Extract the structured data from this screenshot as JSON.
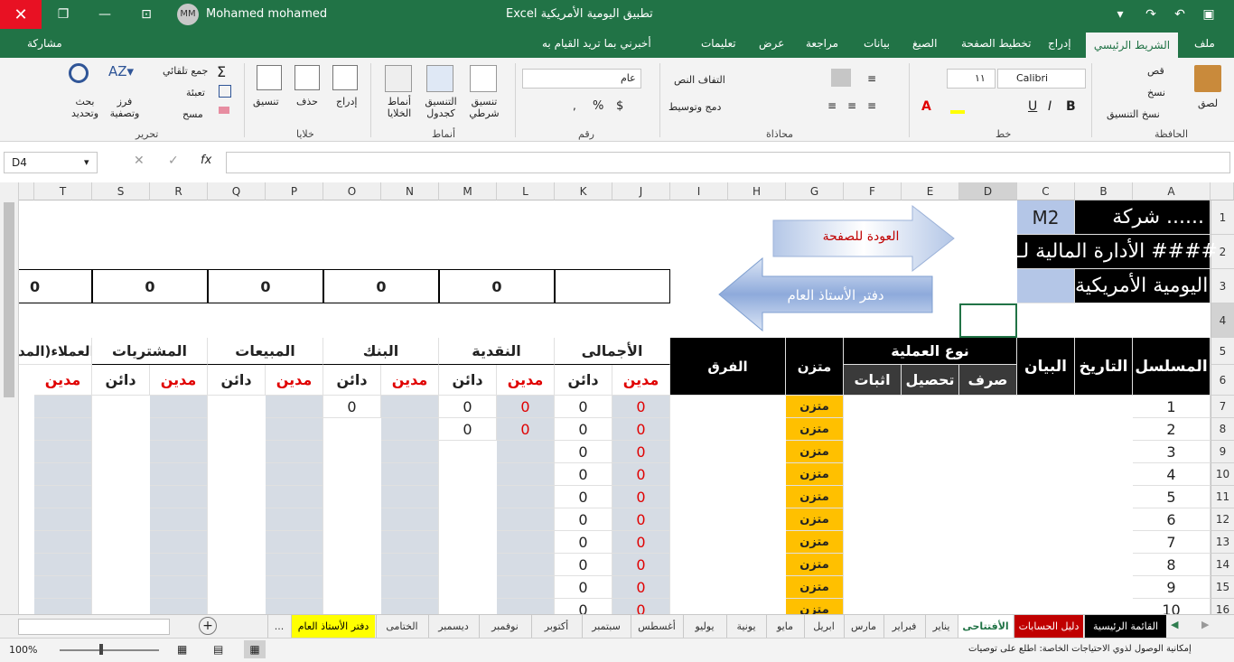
{
  "window": {
    "user_initials": "MM",
    "user_name": "Mohamed mohamed",
    "title": "Excel   تطبيق اليومية الأمريكية"
  },
  "tabs": {
    "file": "ملف",
    "home": "الشريط الرئيسي",
    "insert": "إدراج",
    "page_layout": "تخطيط الصفحة",
    "formulas": "الصيغ",
    "data": "بيانات",
    "review": "مراجعة",
    "view": "عرض",
    "help": "تعليمات",
    "tell_me": "أخبرني بما تريد القيام به",
    "share": "مشاركة"
  },
  "ribbon": {
    "clipboard": {
      "label": "الحافظة",
      "paste": "لصق",
      "cut": "قص",
      "copy": "نسخ",
      "format_painter": "نسخ التنسيق"
    },
    "font": {
      "label": "خط",
      "name": "Calibri",
      "size": "١١"
    },
    "alignment": {
      "label": "محاذاة",
      "wrap": "التفاف النص",
      "merge": "دمج وتوسيط"
    },
    "number": {
      "label": "رقم",
      "format": "عام"
    },
    "styles": {
      "label": "أنماط",
      "conditional": "تنسيق شرطي",
      "as_table": "التنسيق كجدول",
      "cell_styles": "أنماط الخلايا"
    },
    "cells": {
      "label": "خلايا",
      "insert": "إدراج",
      "delete": "حذف",
      "format": "تنسيق"
    },
    "editing": {
      "label": "تحرير",
      "autosum": "جمع تلقائي",
      "fill": "تعبئة",
      "clear": "مسح",
      "sort": "فرز وتصفية",
      "find": "بحث وتحديد"
    }
  },
  "formula_bar": {
    "name_box": "D4",
    "fx": "fx"
  },
  "columns": [
    "A",
    "B",
    "C",
    "D",
    "E",
    "F",
    "G",
    "H",
    "I",
    "J",
    "K",
    "L",
    "M",
    "N",
    "O",
    "P",
    "Q",
    "R",
    "S",
    "T"
  ],
  "rows": [
    "1",
    "2",
    "3",
    "4",
    "5",
    "6",
    "7",
    "8",
    "9",
    "10",
    "11",
    "12",
    "13",
    "14",
    "15",
    "16"
  ],
  "sheet": {
    "company_line1": "شركة ......",
    "company_line2": "الأدارة المالية لـ ####",
    "company_line3": "اليومية الأمريكية",
    "code": "M2",
    "back_arrow": "العودة للصفحة",
    "ledger_arrow": "دفتر الأستاذ العام",
    "totals": [
      "0",
      "0",
      "0",
      "0",
      "0"
    ],
    "headers": {
      "serial": "المسلسل",
      "date": "التاريخ",
      "statement": "البيان",
      "op_type": "نوع العملية",
      "pay": "صرف",
      "collect": "تحصيل",
      "proof": "اثبات",
      "balanced": "متزن",
      "difference": "الفرق",
      "total": "الأجمالى",
      "cash": "النقدية",
      "bank": "البنك",
      "sales": "المبيعات",
      "purchases": "المشتريات",
      "clients": "العملاء(المد",
      "debit": "مدين",
      "credit": "دائن"
    },
    "serials": [
      "1",
      "2",
      "3",
      "4",
      "5",
      "6",
      "7",
      "8",
      "9",
      "10"
    ],
    "status_word": "متزن",
    "zero": "0"
  },
  "sheet_tabs": [
    "القائمة الرئيسية",
    "دليل الحسابات",
    "الأفتتاحى",
    "يناير",
    "فبراير",
    "مارس",
    "ابريل",
    "مايو",
    "يونية",
    "يوليو",
    "أغسطس",
    "سبتمبر",
    "أكتوبر",
    "نوفمبر",
    "ديسمبر",
    "الختامى",
    "دفتر الأستاذ العام",
    "..."
  ],
  "status": {
    "accessibility": "إمكانية الوصول لذوي الاحتياجات الخاصة: اطلع على توصيات",
    "zoom": "100%"
  }
}
